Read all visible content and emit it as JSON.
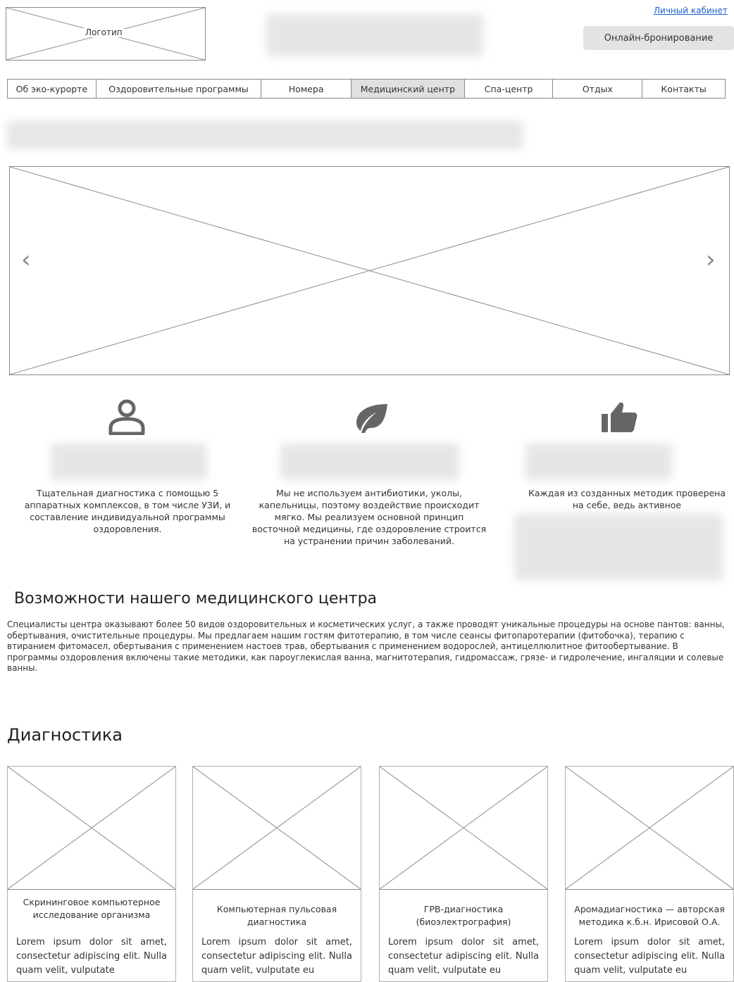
{
  "header": {
    "logo_text": "Логотип",
    "account_link": "Личный кабинет",
    "booking_button": "Онлайн-бронирование"
  },
  "nav": {
    "items": [
      {
        "label": "Об эко-курорте"
      },
      {
        "label": "Оздоровительные программы"
      },
      {
        "label": "Номера"
      },
      {
        "label": "Медицинский центр",
        "active": true
      },
      {
        "label": "Спа-центр"
      },
      {
        "label": "Отдых"
      },
      {
        "label": "Контакты"
      }
    ]
  },
  "slider": {
    "prev_glyph": "‹",
    "next_glyph": "›"
  },
  "features": [
    {
      "icon": "user-icon",
      "text": "Тщательная диагностика с помощью 5 аппаратных комплексов, в том числе УЗИ, и составление индивидуальной программы оздоровления."
    },
    {
      "icon": "leaf-icon",
      "text": "Мы не используем антибиотики, уколы, капельницы, поэтому воздействие происходит мягко. Мы реализуем основной принцип восточной медицины, где оздоровление строится на устранении причин заболеваний."
    },
    {
      "icon": "thumbs-up-icon",
      "text": "Каждая из созданных методик проверена на себе, ведь активное"
    }
  ],
  "capabilities": {
    "title": "Возможности нашего медицинского центра",
    "text": "Специалисты центра оказывают более 50 видов оздоровительных и косметических услуг, а также проводят уникальные процедуры на основе пантов: ванны, обертывания, очистительные процедуры. Мы предлагаем нашим гостям фитотерапию, в том числе сеансы фитопаротерапии (фитобочка), терапию с втиранием фитомасел, обертывания с применением настоев трав, обертывания с применением водорослей, антицеллюлитное фитообертывание. В программы оздоровления включены такие методики, как пароуглекислая ванна, магнитотерапия, гидромассаж, грязе- и гидролечение, ингаляции и солевые ванны."
  },
  "diagnostics": {
    "title": "Диагностика",
    "cards": [
      {
        "title": "Скрининговое компьютерное исследование организма",
        "body": "Lorem ipsum dolor sit amet, consectetur adipiscing elit. Nulla quam velit, vulputate"
      },
      {
        "title": "Компьютерная пульсовая диагностика",
        "body": "Lorem ipsum dolor sit amet, consectetur adipiscing elit. Nulla quam velit, vulputate eu"
      },
      {
        "title": "ГРВ-диагностика (биоэлектрография)",
        "body": "Lorem ipsum dolor sit amet, consectetur adipiscing elit. Nulla quam velit, vulputate eu"
      },
      {
        "title": "Аромадиагностика — авторская методика к.б.н. Ирисовой О.А.",
        "body": "Lorem ipsum dolor sit amet, consectetur adipiscing elit. Nulla quam velit, vulputate eu"
      }
    ]
  }
}
